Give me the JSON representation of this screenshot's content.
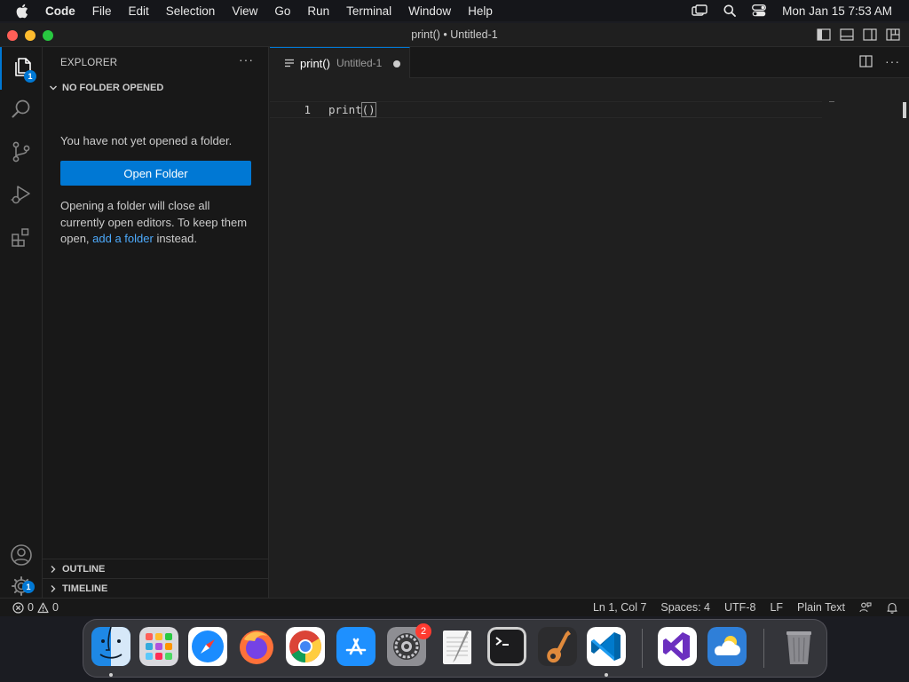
{
  "menubar": {
    "app_name": "Code",
    "items": [
      "File",
      "Edit",
      "Selection",
      "View",
      "Go",
      "Run",
      "Terminal",
      "Window",
      "Help"
    ],
    "clock": "Mon Jan 15  7:53 AM",
    "icons": [
      "apple-logo-icon",
      "screen-mirroring-icon",
      "spotlight-search-icon",
      "control-center-icon"
    ]
  },
  "window": {
    "title": "print() • Untitled-1",
    "layout_icons": [
      "toggle-primary-sidebar-icon",
      "toggle-panel-icon",
      "toggle-secondary-sidebar-icon",
      "customize-layout-icon"
    ]
  },
  "activity_bar": {
    "items": [
      {
        "name": "explorer-icon",
        "badge": "1",
        "active": true
      },
      {
        "name": "search-icon"
      },
      {
        "name": "source-control-icon"
      },
      {
        "name": "run-debug-icon"
      },
      {
        "name": "extensions-icon"
      }
    ],
    "bottom": [
      {
        "name": "accounts-icon"
      },
      {
        "name": "manage-gear-icon",
        "badge": "1"
      }
    ],
    "accent": "#0078d4"
  },
  "sidebar": {
    "title": "EXPLORER",
    "more_label": "···",
    "section_title": "NO FOLDER OPENED",
    "message": "You have not yet opened a folder.",
    "open_button": "Open Folder",
    "info_prefix": "Opening a folder will close all currently open editors. To keep them open, ",
    "info_link": "add a folder",
    "info_suffix": " instead.",
    "outline_label": "OUTLINE",
    "timeline_label": "TIMELINE"
  },
  "editor": {
    "tab": {
      "name": "print()",
      "description": "Untitled-1",
      "dirty": true
    },
    "more_label": "···",
    "line_numbers": [
      "1"
    ],
    "code_prefix": "print",
    "code_parens": "()"
  },
  "statusbar": {
    "errors": "0",
    "warnings": "0",
    "position": "Ln 1, Col 7",
    "spaces": "Spaces: 4",
    "encoding": "UTF-8",
    "eol": "LF",
    "language": "Plain Text"
  },
  "dock": {
    "apps": [
      "Finder",
      "Launchpad",
      "Safari",
      "Firefox",
      "Google Chrome",
      "App Store",
      "System Settings",
      "TextEdit",
      "Terminal",
      "GarageBand",
      "Visual Studio Code",
      "Visual Studio",
      "Weather",
      "Trash"
    ],
    "system_settings_badge": "2"
  }
}
